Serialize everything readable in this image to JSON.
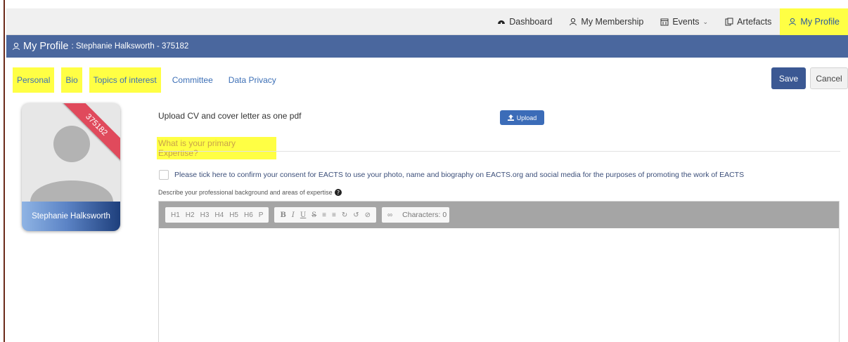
{
  "topnav": {
    "items": [
      {
        "label": "Dashboard",
        "icon": "dashboard-icon"
      },
      {
        "label": "My Membership",
        "icon": "user-icon"
      },
      {
        "label": "Events",
        "icon": "calendar-icon"
      },
      {
        "label": "Artefacts",
        "icon": "documents-icon"
      },
      {
        "label": "My Profile",
        "icon": "user-icon",
        "active": true
      }
    ]
  },
  "titlebar": {
    "title": "My Profile",
    "subtitle": ": Stephanie Halksworth - 375182"
  },
  "tabs": [
    {
      "label": "Personal",
      "highlighted": true
    },
    {
      "label": "Bio",
      "highlighted": true
    },
    {
      "label": "Topics of interest",
      "highlighted": true
    },
    {
      "label": "Committee",
      "highlighted": false
    },
    {
      "label": "Data Privacy",
      "highlighted": false
    }
  ],
  "actions": {
    "save": "Save",
    "cancel": "Cancel"
  },
  "profile_card": {
    "id_badge": "375182",
    "name": "Stephanie Halksworth"
  },
  "upload": {
    "label": "Upload CV and cover letter as one pdf",
    "button": "Upload"
  },
  "expertise": {
    "question": "What is your primary Expertise?"
  },
  "consent": {
    "text": "Please tick here to confirm your consent for EACTS to use your photo, name and biography on EACTS.org and social media for the purposes of promoting the work of EACTS",
    "checked": false
  },
  "describe": {
    "label": "Describe your professional background and areas of expertise"
  },
  "editor": {
    "headings": [
      "H1",
      "H2",
      "H3",
      "H4",
      "H5",
      "H6",
      "P"
    ],
    "formatting": [
      "B",
      "I",
      "U",
      "S"
    ],
    "characters": "Characters: 0"
  },
  "colors": {
    "header_blue": "#4a679e",
    "highlight": "#ffff44",
    "ribbon": "#e04a5c",
    "save": "#3b5893"
  }
}
